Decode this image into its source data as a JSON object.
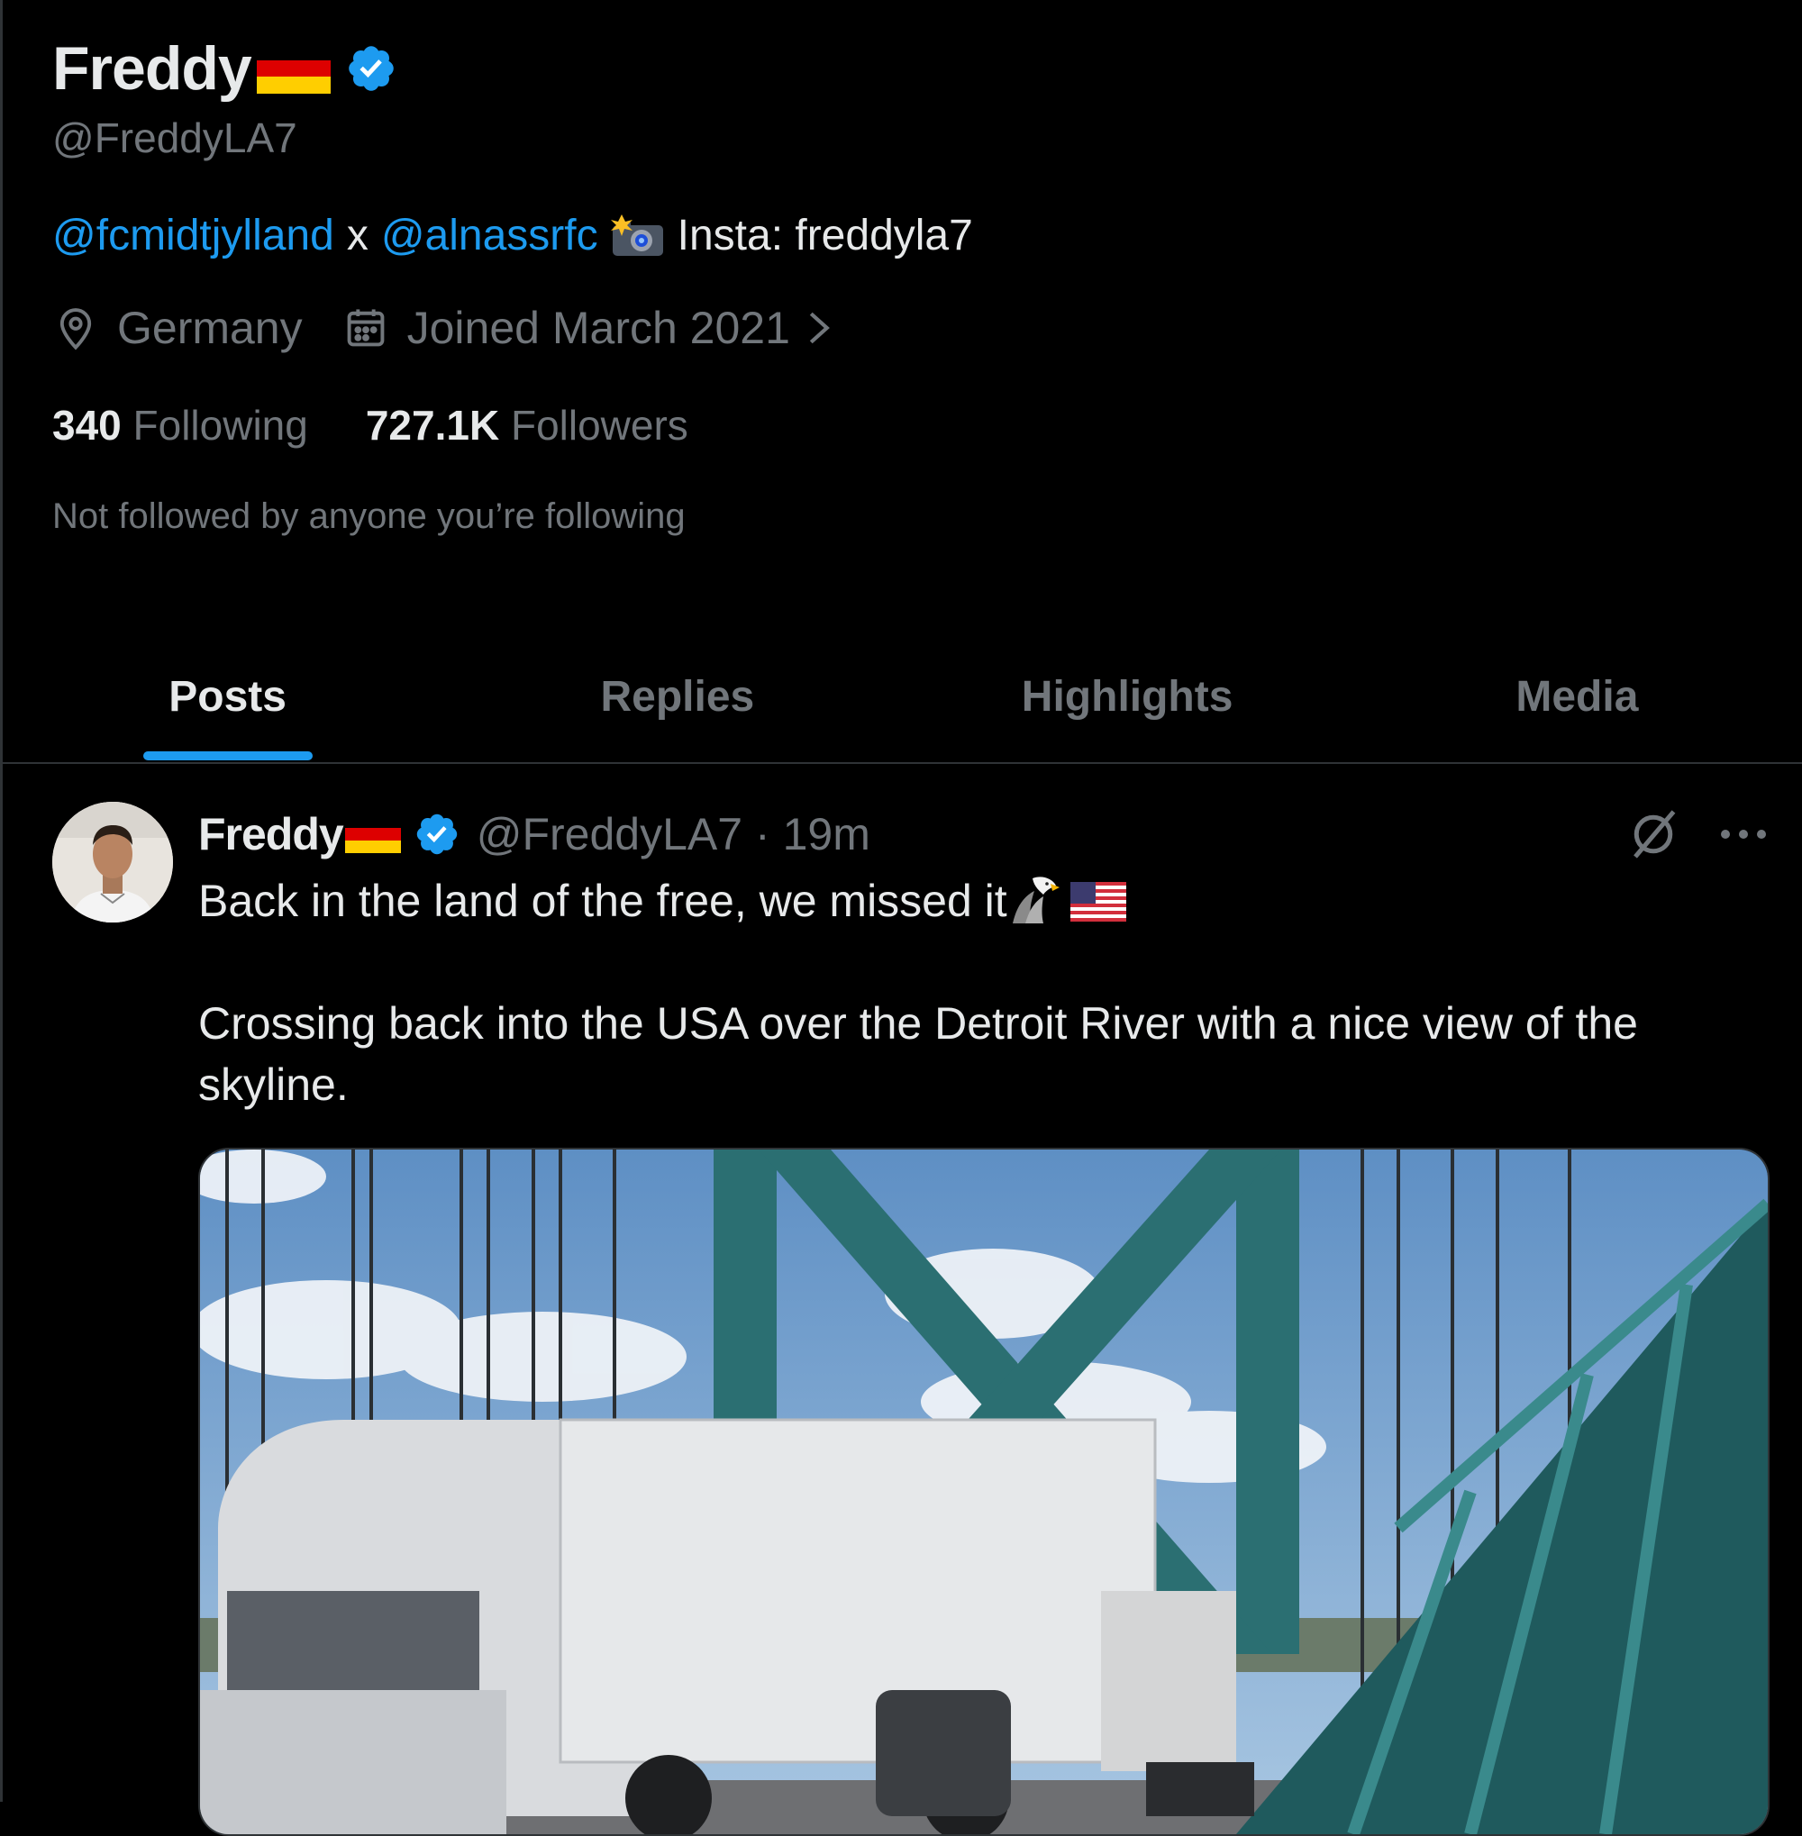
{
  "profile": {
    "display_name": "Freddy",
    "handle": "@FreddyLA7",
    "bio": {
      "mention1": "@fcmidtjylland",
      "separator": "x",
      "mention2": "@alnassrfc",
      "insta": "Insta: freddyla7"
    },
    "location": "Germany",
    "joined": "Joined March 2021",
    "following_count": "340",
    "following_label": "Following",
    "followers_count": "727.1K",
    "followers_label": "Followers",
    "followed_by": "Not followed by anyone you’re following"
  },
  "tabs": [
    {
      "label": "Posts",
      "active": true
    },
    {
      "label": "Replies",
      "active": false
    },
    {
      "label": "Highlights",
      "active": false
    },
    {
      "label": "Media",
      "active": false
    }
  ],
  "post": {
    "author_name": "Freddy",
    "author_handle": "@FreddyLA7",
    "time": "· 19m",
    "line1": "Back in the land of the free, we missed it",
    "line2": "Crossing back into the USA over the Detroit River with a nice view of the skyline."
  },
  "colors": {
    "accent": "#1d9bf0",
    "background": "#000000",
    "text_primary": "#e7e9ea",
    "text_secondary": "#71767b",
    "divider": "#2f3336"
  }
}
